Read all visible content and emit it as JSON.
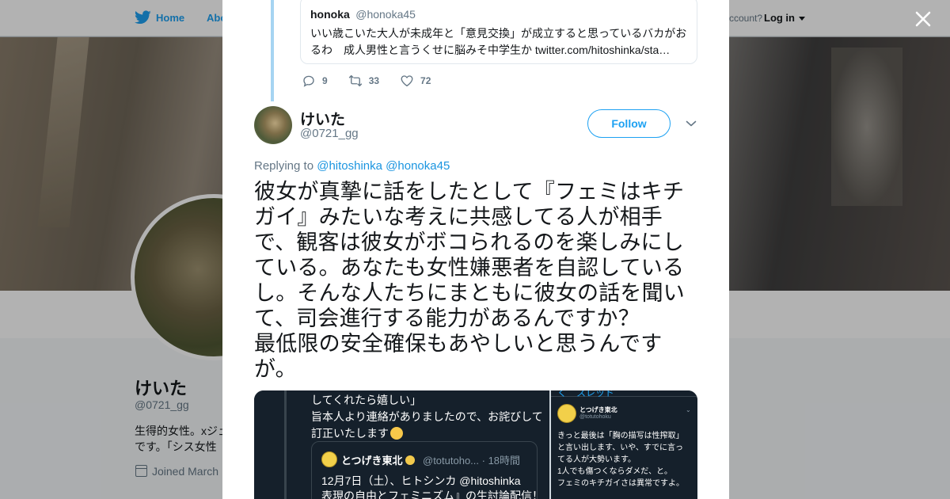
{
  "topnav": {
    "home_label": "Home",
    "about_label": "Abo",
    "account_text": "ccount?",
    "login_label": "Log in"
  },
  "profile": {
    "name": "けいた",
    "handle": "@0721_gg",
    "bio": "生得的女性。xジェ\nです。「シス女性",
    "joined": "Joined March"
  },
  "quoted_tweet": {
    "name": "honoka",
    "handle": "@honoka45",
    "text": "いい歳こいた大人が未成年と「意見交換」が成立すると思っているバカがおるわ　成人男性と言うくせに脳みそ中学生か twitter.com/hitoshinka/sta…"
  },
  "parent_actions": {
    "replies": "9",
    "retweets": "33",
    "likes": "72"
  },
  "tweet": {
    "author_name": "けいた",
    "author_handle": "@0721_gg",
    "follow_label": "Follow",
    "replying_prefix": "Replying to",
    "replying_to_1": "@hitoshinka",
    "replying_to_2": "@honoka45",
    "text": "彼女が真摯に話をしたとして『フェミはキチガイ』みたいな考えに共感してる人が相手で、観客は彼女がボコられるのを楽しみにしている。あなたも女性嫌悪者を自認しているし。そんな人たちにまともに彼女の話を聞いて、司会進行する能力があるんですか？\n最低限の安全確保もあやしいと思うんですが。"
  },
  "media": {
    "left_text": "してくれたら嬉しい」\n旨本人より連絡がありましたので、お詫びして\n訂正いたします",
    "quote_name": "とつげき東北",
    "quote_handle": "@totutoho... · 18時間",
    "quote_text": "12月7日（土）、ヒトシンカ @hitoshinka\n表現の自由とフェミニズム』の生討論配信！",
    "right_back": "く　スレッド",
    "right_name": "とつげき東北",
    "right_handle": "@totutohoku",
    "right_text": "きっと最後は「胸の描写は性搾取」\nと言い出します、いや、すでに言っ\nてる人が大勢います。\n1人でも傷つくならダメだ、と。\nフェミのキチガイさは異常ですよ。"
  },
  "icons": {
    "close": "close-icon",
    "reply": "reply-icon",
    "retweet": "retweet-icon",
    "like": "heart-icon",
    "bird": "twitter-bird-icon",
    "calendar": "calendar-icon"
  },
  "colors": {
    "brand": "#1da1f2",
    "link": "#1b95e0",
    "thread": "#a6d4f2",
    "muted": "#657786",
    "text": "#14171a"
  }
}
